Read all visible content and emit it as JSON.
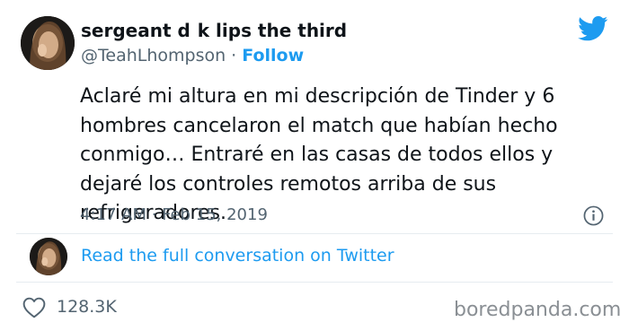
{
  "author": {
    "display_name": "sergeant d  k lips the third",
    "handle": "@TeahLhompson",
    "separator": " · ",
    "follow_label": "Follow"
  },
  "tweet": {
    "text": "Aclaré mi altura en mi descripción de Tinder y 6 hombres cancelaron el match que habían hecho conmigo… Entraré en las casas de todos ellos y dejaré los controles remotos arriba de sus refrigeradores.",
    "timestamp": "4:17 AM · Feb 15, 2019"
  },
  "conversation": {
    "link_label": "Read the full conversation on Twitter"
  },
  "stats": {
    "likes": "128.3K"
  },
  "watermark": "boredpanda.com",
  "colors": {
    "twitter_blue": "#1d9bf0",
    "secondary_text": "#536471",
    "primary_text": "#0f1419"
  },
  "icons": {
    "brand": "twitter-bird-icon",
    "info": "info-icon",
    "like": "heart-icon"
  }
}
